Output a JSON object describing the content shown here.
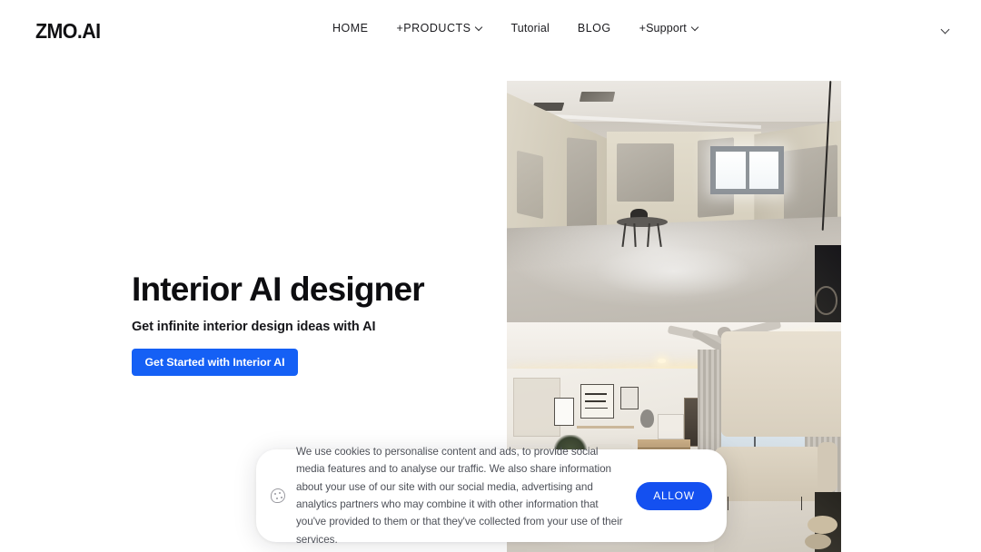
{
  "header": {
    "logo": "ZMO.AI",
    "nav": [
      {
        "label": "HOME",
        "has_dropdown": false
      },
      {
        "label": "+PRODUCTS",
        "has_dropdown": true
      },
      {
        "label": "Tutorial",
        "has_dropdown": false
      },
      {
        "label": "BLOG",
        "has_dropdown": false
      },
      {
        "label": "+Support",
        "has_dropdown": true
      }
    ],
    "lang_toggle_icon": "chevron-down-icon"
  },
  "hero": {
    "title": "Interior AI designer",
    "subtitle": "Get infinite interior design ideas with AI",
    "cta_label": "Get Started with Interior AI",
    "cta_color": "#1560f5"
  },
  "showcase": {
    "before_alt": "Unfinished raw concrete room with bare walls, small window and a stool",
    "after_alt": "AI redesigned modern living room with beige sofa, ceiling fan, curtains and framed art"
  },
  "cookie_banner": {
    "icon": "cookie-icon",
    "message": "We use cookies to personalise content and ads, to provide social media features and to analyse our traffic. We also share information about your use of our site with our social media, advertising and analytics partners who may combine it with other information that you've provided to them or that they've collected from your use of their services.",
    "allow_label": "ALLOW",
    "allow_color": "#1450f0"
  },
  "theme": {
    "background": "#ffffff",
    "text": "#1b1b1f",
    "muted_text": "#4d5058",
    "accent": "#1560f5"
  }
}
